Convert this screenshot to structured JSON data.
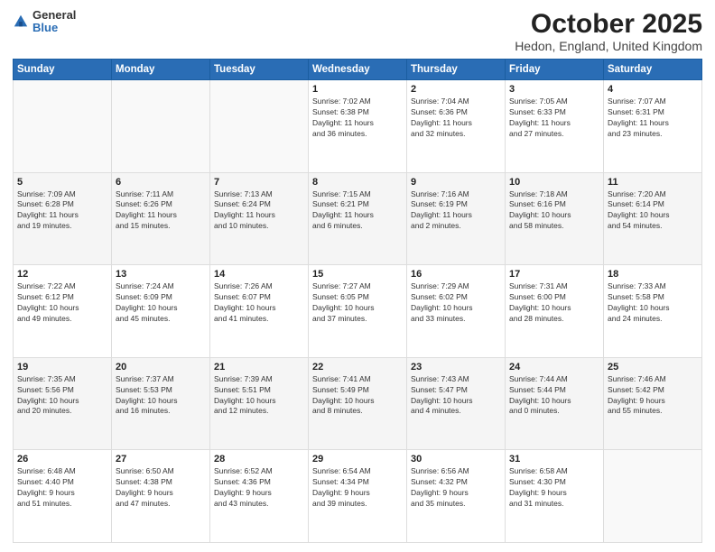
{
  "logo": {
    "general": "General",
    "blue": "Blue"
  },
  "title": {
    "month": "October 2025",
    "location": "Hedon, England, United Kingdom"
  },
  "weekdays": [
    "Sunday",
    "Monday",
    "Tuesday",
    "Wednesday",
    "Thursday",
    "Friday",
    "Saturday"
  ],
  "weeks": [
    [
      {
        "day": "",
        "info": ""
      },
      {
        "day": "",
        "info": ""
      },
      {
        "day": "",
        "info": ""
      },
      {
        "day": "1",
        "info": "Sunrise: 7:02 AM\nSunset: 6:38 PM\nDaylight: 11 hours\nand 36 minutes."
      },
      {
        "day": "2",
        "info": "Sunrise: 7:04 AM\nSunset: 6:36 PM\nDaylight: 11 hours\nand 32 minutes."
      },
      {
        "day": "3",
        "info": "Sunrise: 7:05 AM\nSunset: 6:33 PM\nDaylight: 11 hours\nand 27 minutes."
      },
      {
        "day": "4",
        "info": "Sunrise: 7:07 AM\nSunset: 6:31 PM\nDaylight: 11 hours\nand 23 minutes."
      }
    ],
    [
      {
        "day": "5",
        "info": "Sunrise: 7:09 AM\nSunset: 6:28 PM\nDaylight: 11 hours\nand 19 minutes."
      },
      {
        "day": "6",
        "info": "Sunrise: 7:11 AM\nSunset: 6:26 PM\nDaylight: 11 hours\nand 15 minutes."
      },
      {
        "day": "7",
        "info": "Sunrise: 7:13 AM\nSunset: 6:24 PM\nDaylight: 11 hours\nand 10 minutes."
      },
      {
        "day": "8",
        "info": "Sunrise: 7:15 AM\nSunset: 6:21 PM\nDaylight: 11 hours\nand 6 minutes."
      },
      {
        "day": "9",
        "info": "Sunrise: 7:16 AM\nSunset: 6:19 PM\nDaylight: 11 hours\nand 2 minutes."
      },
      {
        "day": "10",
        "info": "Sunrise: 7:18 AM\nSunset: 6:16 PM\nDaylight: 10 hours\nand 58 minutes."
      },
      {
        "day": "11",
        "info": "Sunrise: 7:20 AM\nSunset: 6:14 PM\nDaylight: 10 hours\nand 54 minutes."
      }
    ],
    [
      {
        "day": "12",
        "info": "Sunrise: 7:22 AM\nSunset: 6:12 PM\nDaylight: 10 hours\nand 49 minutes."
      },
      {
        "day": "13",
        "info": "Sunrise: 7:24 AM\nSunset: 6:09 PM\nDaylight: 10 hours\nand 45 minutes."
      },
      {
        "day": "14",
        "info": "Sunrise: 7:26 AM\nSunset: 6:07 PM\nDaylight: 10 hours\nand 41 minutes."
      },
      {
        "day": "15",
        "info": "Sunrise: 7:27 AM\nSunset: 6:05 PM\nDaylight: 10 hours\nand 37 minutes."
      },
      {
        "day": "16",
        "info": "Sunrise: 7:29 AM\nSunset: 6:02 PM\nDaylight: 10 hours\nand 33 minutes."
      },
      {
        "day": "17",
        "info": "Sunrise: 7:31 AM\nSunset: 6:00 PM\nDaylight: 10 hours\nand 28 minutes."
      },
      {
        "day": "18",
        "info": "Sunrise: 7:33 AM\nSunset: 5:58 PM\nDaylight: 10 hours\nand 24 minutes."
      }
    ],
    [
      {
        "day": "19",
        "info": "Sunrise: 7:35 AM\nSunset: 5:56 PM\nDaylight: 10 hours\nand 20 minutes."
      },
      {
        "day": "20",
        "info": "Sunrise: 7:37 AM\nSunset: 5:53 PM\nDaylight: 10 hours\nand 16 minutes."
      },
      {
        "day": "21",
        "info": "Sunrise: 7:39 AM\nSunset: 5:51 PM\nDaylight: 10 hours\nand 12 minutes."
      },
      {
        "day": "22",
        "info": "Sunrise: 7:41 AM\nSunset: 5:49 PM\nDaylight: 10 hours\nand 8 minutes."
      },
      {
        "day": "23",
        "info": "Sunrise: 7:43 AM\nSunset: 5:47 PM\nDaylight: 10 hours\nand 4 minutes."
      },
      {
        "day": "24",
        "info": "Sunrise: 7:44 AM\nSunset: 5:44 PM\nDaylight: 10 hours\nand 0 minutes."
      },
      {
        "day": "25",
        "info": "Sunrise: 7:46 AM\nSunset: 5:42 PM\nDaylight: 9 hours\nand 55 minutes."
      }
    ],
    [
      {
        "day": "26",
        "info": "Sunrise: 6:48 AM\nSunset: 4:40 PM\nDaylight: 9 hours\nand 51 minutes."
      },
      {
        "day": "27",
        "info": "Sunrise: 6:50 AM\nSunset: 4:38 PM\nDaylight: 9 hours\nand 47 minutes."
      },
      {
        "day": "28",
        "info": "Sunrise: 6:52 AM\nSunset: 4:36 PM\nDaylight: 9 hours\nand 43 minutes."
      },
      {
        "day": "29",
        "info": "Sunrise: 6:54 AM\nSunset: 4:34 PM\nDaylight: 9 hours\nand 39 minutes."
      },
      {
        "day": "30",
        "info": "Sunrise: 6:56 AM\nSunset: 4:32 PM\nDaylight: 9 hours\nand 35 minutes."
      },
      {
        "day": "31",
        "info": "Sunrise: 6:58 AM\nSunset: 4:30 PM\nDaylight: 9 hours\nand 31 minutes."
      },
      {
        "day": "",
        "info": ""
      }
    ]
  ]
}
